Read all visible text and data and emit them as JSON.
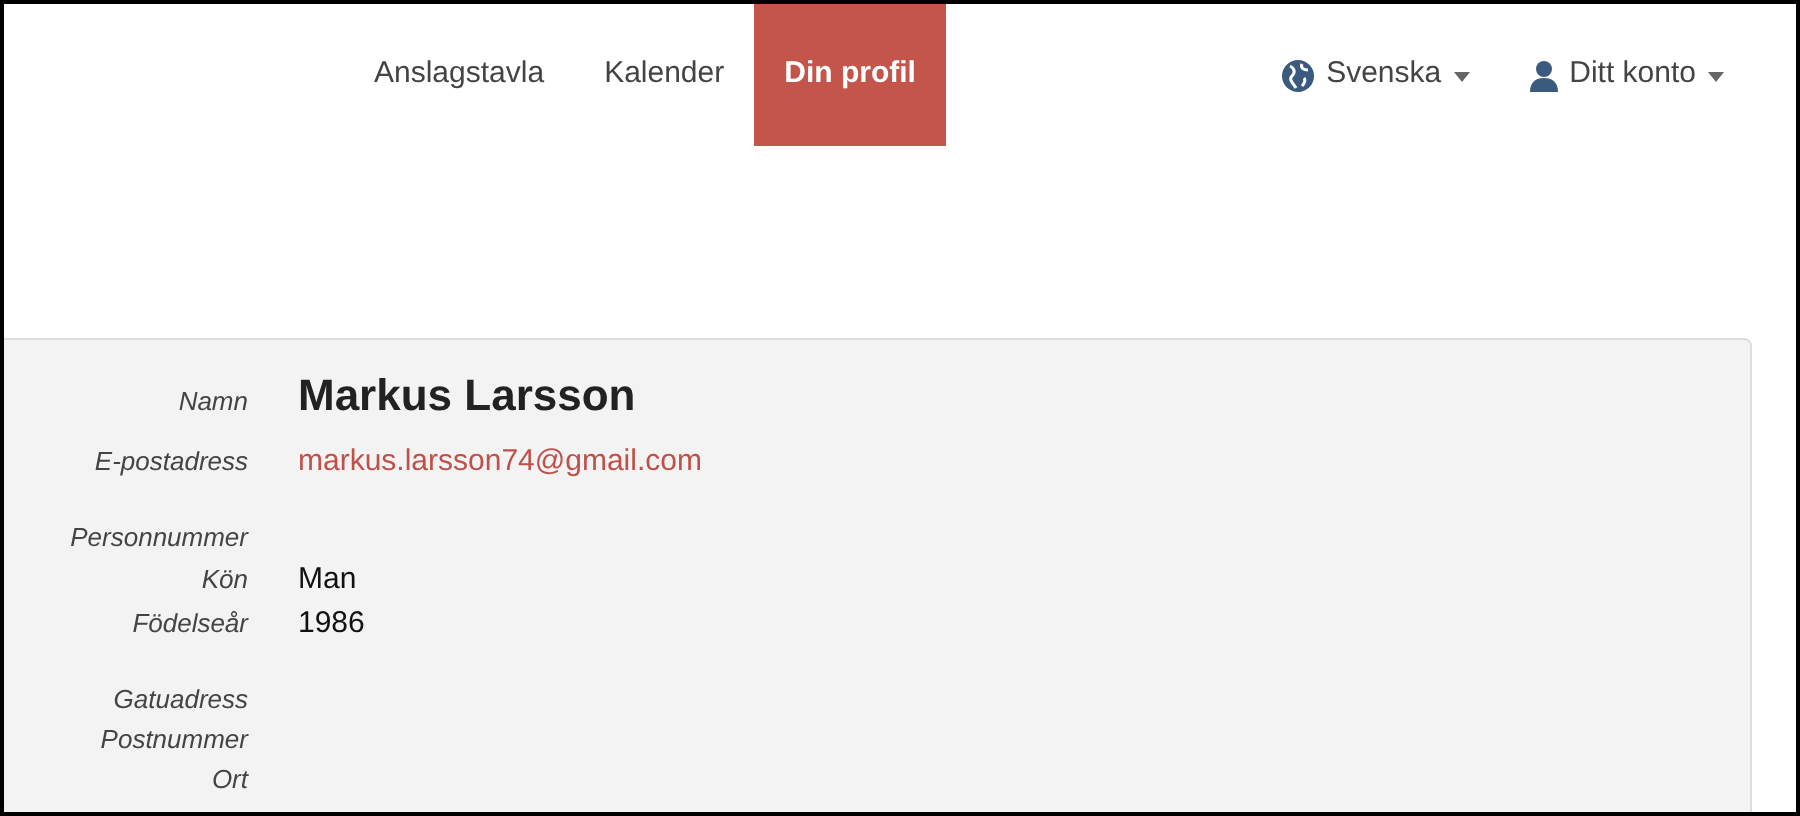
{
  "nav": {
    "items": [
      {
        "label": "Anslagstavla",
        "selected": false
      },
      {
        "label": "Kalender",
        "selected": false
      },
      {
        "label": "Din profil",
        "selected": true
      }
    ],
    "language": {
      "label": "Svenska"
    },
    "account": {
      "label": "Ditt konto"
    }
  },
  "profile": {
    "groups": [
      {
        "fields": [
          {
            "kind": "name",
            "label": "Namn",
            "value": "Markus Larsson"
          },
          {
            "kind": "email",
            "label": "E-postadress",
            "value": "markus.larsson74@gmail.com"
          }
        ]
      },
      {
        "fields": [
          {
            "label": "Personnummer"
          },
          {
            "kind": "text",
            "label": "Kön",
            "value": "Man"
          },
          {
            "kind": "text",
            "label": "Födelseår",
            "value": "1986"
          }
        ]
      },
      {
        "fields": [
          {
            "label": "Gatuadress"
          },
          {
            "label": "Postnummer"
          },
          {
            "label": "Ort"
          }
        ]
      }
    ]
  }
}
